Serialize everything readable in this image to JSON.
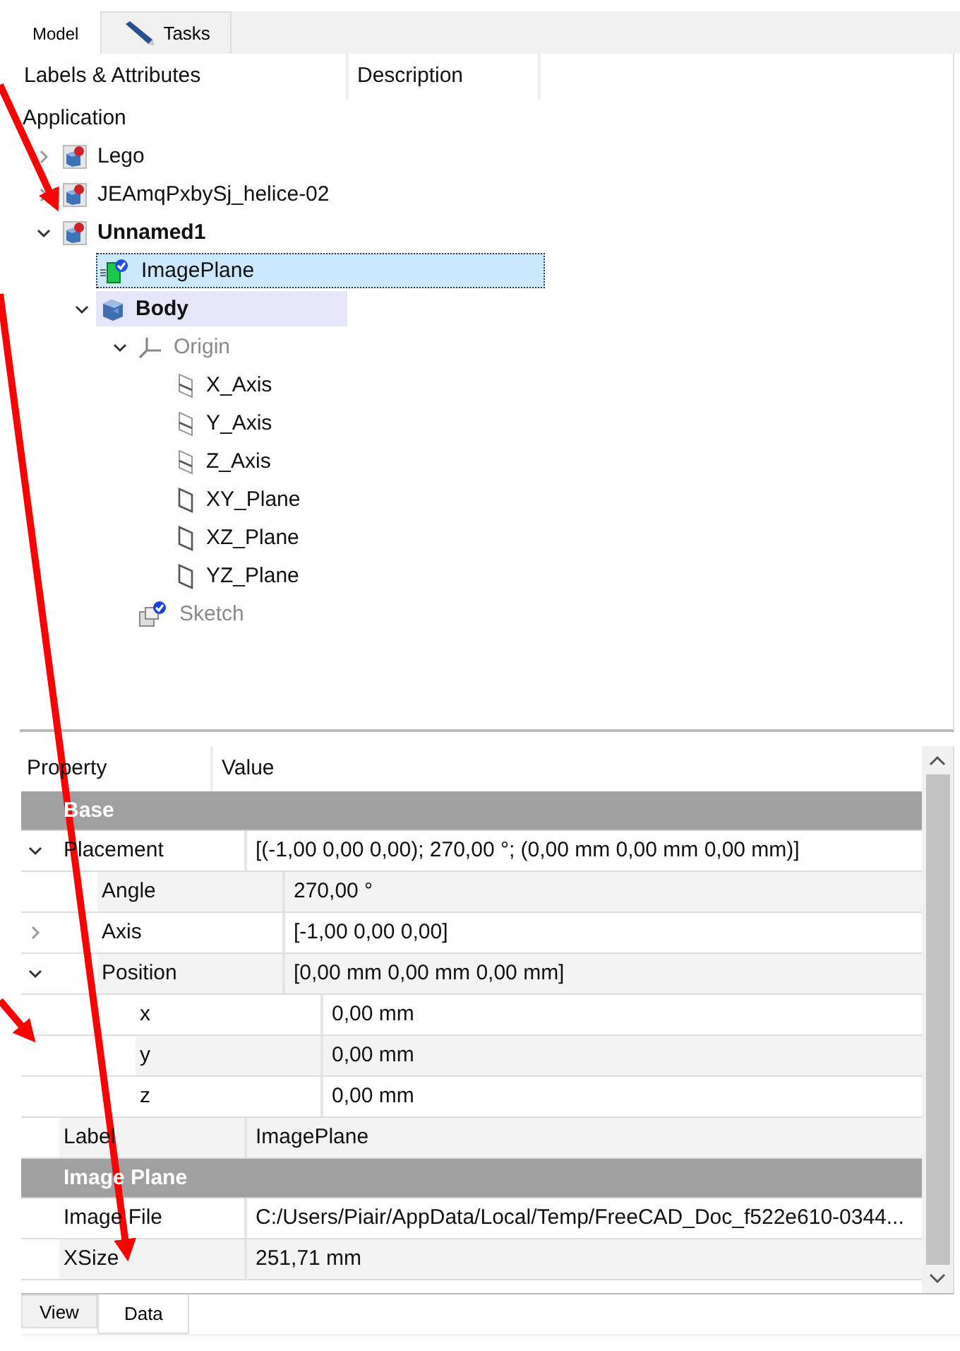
{
  "tabs": [
    {
      "label": "Model",
      "selected": true
    },
    {
      "label": "Tasks",
      "selected": false
    }
  ],
  "tree": {
    "columns": [
      "Labels & Attributes",
      "Description"
    ],
    "root": "Application",
    "items": [
      {
        "label": "Lego",
        "kind": "document",
        "expanded": false,
        "selected": false,
        "active": false,
        "visible": true
      },
      {
        "label": "JEAmqPxbySj_helice-02",
        "kind": "document",
        "expanded": false,
        "selected": false,
        "active": false,
        "visible": true
      },
      {
        "label": "Unnamed1",
        "kind": "document",
        "expanded": true,
        "selected": false,
        "active": true,
        "visible": true,
        "children": [
          {
            "label": "ImagePlane",
            "kind": "image-plane",
            "selected": true,
            "active": false,
            "visible": true
          },
          {
            "label": "Body",
            "kind": "body",
            "expanded": true,
            "selected": false,
            "active": true,
            "visible": true,
            "children": [
              {
                "label": "Origin",
                "kind": "origin",
                "expanded": true,
                "selected": false,
                "active": false,
                "visible": false,
                "children": [
                  {
                    "label": "X_Axis",
                    "kind": "axis",
                    "selected": false,
                    "active": false,
                    "visible": true
                  },
                  {
                    "label": "Y_Axis",
                    "kind": "axis",
                    "selected": false,
                    "active": false,
                    "visible": true
                  },
                  {
                    "label": "Z_Axis",
                    "kind": "axis",
                    "selected": false,
                    "active": false,
                    "visible": true
                  },
                  {
                    "label": "XY_Plane",
                    "kind": "plane",
                    "selected": false,
                    "active": false,
                    "visible": true
                  },
                  {
                    "label": "XZ_Plane",
                    "kind": "plane",
                    "selected": false,
                    "active": false,
                    "visible": true
                  },
                  {
                    "label": "YZ_Plane",
                    "kind": "plane",
                    "selected": false,
                    "active": false,
                    "visible": true
                  }
                ]
              },
              {
                "label": "Sketch",
                "kind": "sketch",
                "selected": false,
                "active": false,
                "visible": false
              }
            ]
          }
        ]
      }
    ]
  },
  "properties": {
    "columns": [
      "Property",
      "Value"
    ],
    "rows": [
      {
        "kind": "group",
        "name": "Base"
      },
      {
        "kind": "property",
        "name": "Placement",
        "value": "[(-1,00 0,00 0,00); 270,00 °; (0,00 mm  0,00 mm  0,00 mm)]",
        "expanded": true,
        "children": [
          {
            "kind": "property",
            "name": "Angle",
            "value": "270,00 °"
          },
          {
            "kind": "property",
            "name": "Axis",
            "value": "[-1,00 0,00 0,00]",
            "expanded": false
          },
          {
            "kind": "property",
            "name": "Position",
            "value": "[0,00 mm  0,00 mm  0,00 mm]",
            "expanded": true,
            "children": [
              {
                "kind": "property",
                "name": "x",
                "value": "0,00 mm"
              },
              {
                "kind": "property",
                "name": "y",
                "value": "0,00 mm"
              },
              {
                "kind": "property",
                "name": "z",
                "value": "0,00 mm"
              }
            ]
          }
        ]
      },
      {
        "kind": "property",
        "name": "Label",
        "value": "ImagePlane"
      },
      {
        "kind": "group",
        "name": "Image Plane"
      },
      {
        "kind": "property",
        "name": "Image File",
        "value": "C:/Users/Piair/AppData/Local/Temp/FreeCAD_Doc_f522e610-0344..."
      },
      {
        "kind": "property",
        "name": "XSize",
        "value": "251,71 mm"
      }
    ]
  },
  "bottom_tabs": [
    {
      "label": "View",
      "selected": false
    },
    {
      "label": "Data",
      "selected": true
    }
  ]
}
